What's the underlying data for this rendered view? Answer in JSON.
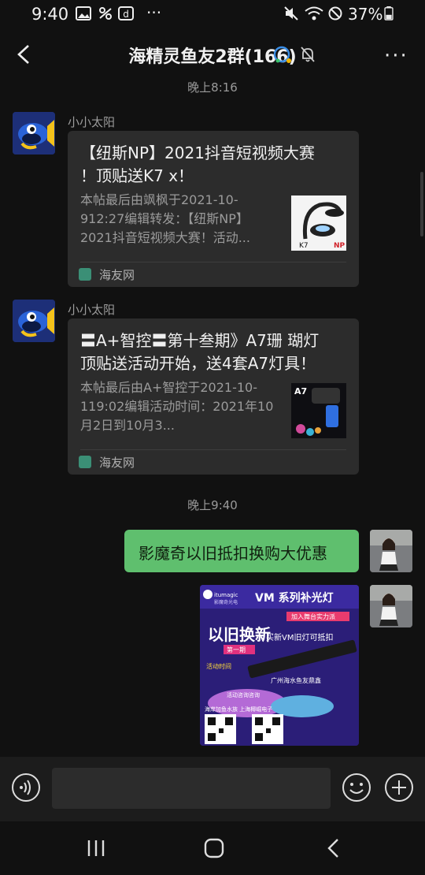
{
  "status": {
    "time": "9:40",
    "battery": "37%",
    "more": "···"
  },
  "header": {
    "title": "海精灵鱼友2群(166)",
    "more": "···"
  },
  "timestamps": [
    "晚上8:16",
    "晚上9:40"
  ],
  "messages": [
    {
      "sender": "小小太阳",
      "title": "【纽斯NP】2021抖音短视频大赛 ！顶贴送K7 x！",
      "desc": "本帖最后由飒枫于2021-10-912:27编辑转发：【纽斯NP】2021抖音短视频大赛！活动...",
      "source": "海友网",
      "thumb_label": "K7"
    },
    {
      "sender": "小小太阳",
      "title": "〓A+智控〓第十叁期》A7珊 瑚灯顶贴送活动开始，送4套A7灯具！",
      "desc": "本帖最后由A+智控于2021-10-119:02编辑活动时间：2021年10月2日到10月3...",
      "source": "海友网",
      "thumb_label": "A7"
    }
  ],
  "own_text": "影魔奇以旧抵扣换购大优惠",
  "poster": {
    "brand": "itumagic",
    "brand_sub": "影魔奇光电",
    "headline": "VM 系列补光灯",
    "tag": "加入舞台实力派",
    "big": "以旧换新",
    "badge": "第一期",
    "offer": "买新VM旧灯可抵扣",
    "time_label": "活动时间",
    "venue": "广州海水鱼友鼎鑫",
    "contact": "活动咨询咨询",
    "shops": "海岸加鱼水族  上海椰崛电子"
  },
  "colors": {
    "bg": "#111111",
    "bubble_green": "#5fbf6e",
    "card": "#2c2c2c"
  }
}
